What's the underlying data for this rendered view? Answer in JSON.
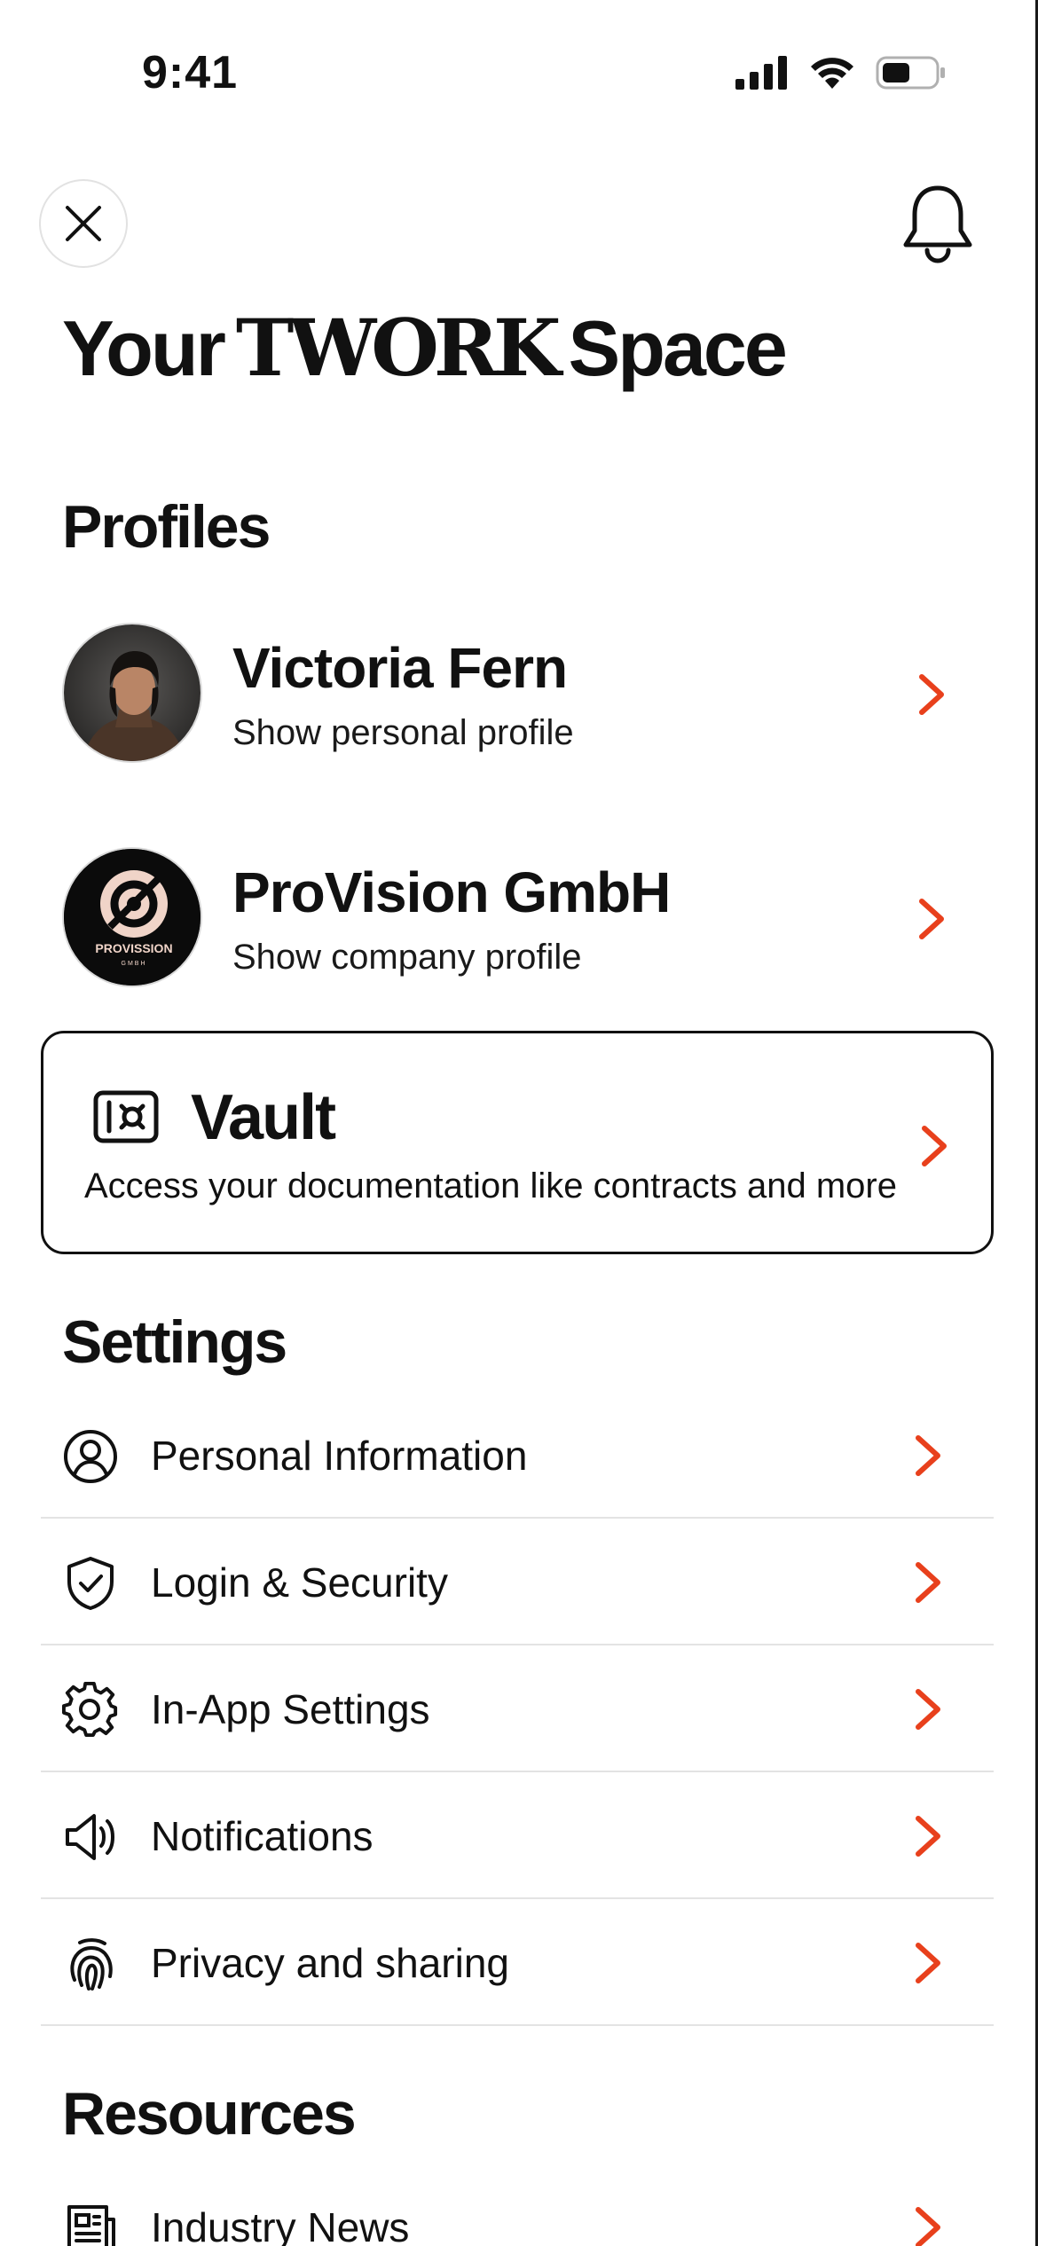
{
  "status_bar": {
    "time": "9:41"
  },
  "header": {
    "title_prefix": "Your",
    "title_brand": "TWORK",
    "title_suffix": "Space"
  },
  "profiles": {
    "section_title": "Profiles",
    "items": [
      {
        "name": "Victoria Fern",
        "subtitle": "Show personal profile"
      },
      {
        "name": "ProVision GmbH",
        "subtitle": "Show company profile",
        "logo_text": "PROVISSION",
        "logo_subtext": "GMBH"
      }
    ]
  },
  "vault": {
    "title": "Vault",
    "subtitle": "Access your documentation like contracts and more"
  },
  "settings": {
    "section_title": "Settings",
    "items": [
      {
        "label": "Personal Information",
        "icon": "user-circle-icon"
      },
      {
        "label": "Login & Security",
        "icon": "shield-check-icon"
      },
      {
        "label": "In-App Settings",
        "icon": "gear-icon"
      },
      {
        "label": "Notifications",
        "icon": "speaker-icon"
      },
      {
        "label": "Privacy and sharing",
        "icon": "fingerprint-icon"
      }
    ]
  },
  "resources": {
    "section_title": "Resources",
    "items": [
      {
        "label": "Industry News",
        "icon": "newspaper-icon"
      }
    ]
  },
  "colors": {
    "accent": "#E8401C",
    "text": "#111111",
    "divider": "#E3E3E3"
  }
}
